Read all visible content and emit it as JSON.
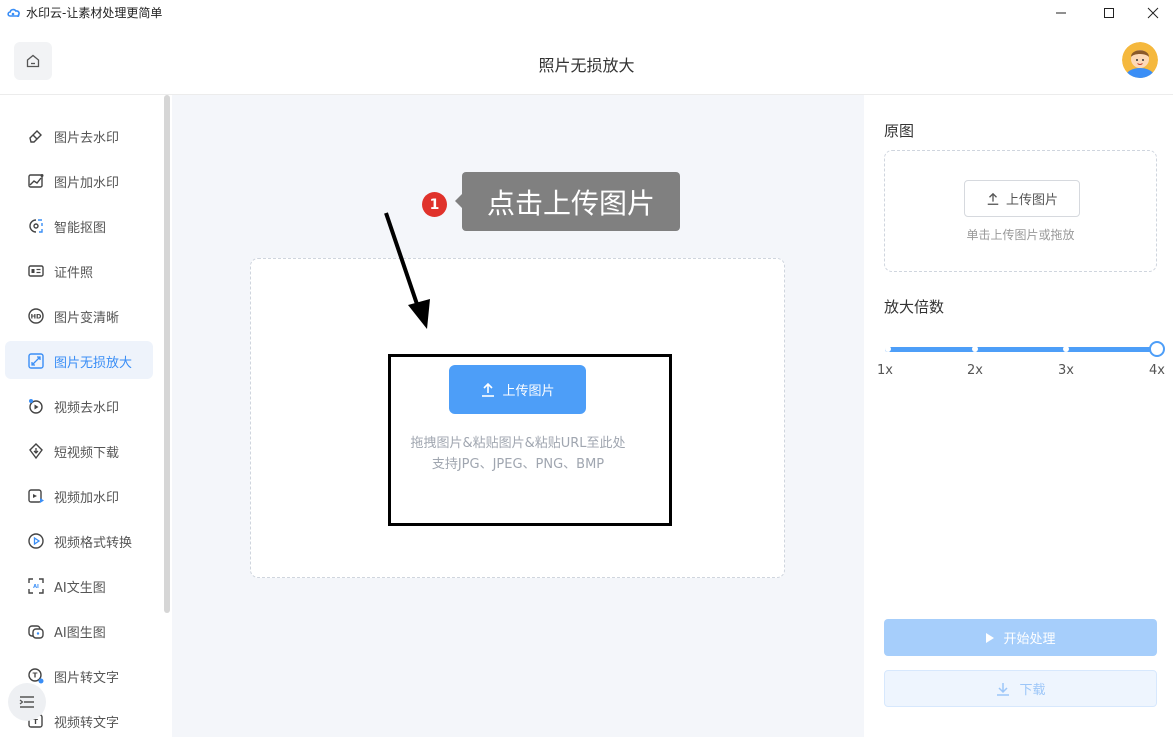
{
  "window": {
    "title": "水印云-让素材处理更简单"
  },
  "header": {
    "page_title": "照片无损放大"
  },
  "sidebar": {
    "items": [
      {
        "label": "图片去水印",
        "icon": "eraser-icon",
        "active": false
      },
      {
        "label": "图片加水印",
        "icon": "image-add-watermark-icon",
        "active": false
      },
      {
        "label": "智能抠图",
        "icon": "cutout-icon",
        "active": false
      },
      {
        "label": "证件照",
        "icon": "id-card-icon",
        "active": false
      },
      {
        "label": "图片变清晰",
        "icon": "hd-icon",
        "active": false
      },
      {
        "label": "图片无损放大",
        "icon": "enlarge-icon",
        "active": true
      },
      {
        "label": "视频去水印",
        "icon": "video-remove-watermark-icon",
        "active": false
      },
      {
        "label": "短视频下载",
        "icon": "download-video-icon",
        "active": false
      },
      {
        "label": "视频加水印",
        "icon": "video-add-watermark-icon",
        "active": false
      },
      {
        "label": "视频格式转换",
        "icon": "video-convert-icon",
        "active": false
      },
      {
        "label": "AI文生图",
        "icon": "ai-text-to-image-icon",
        "active": false
      },
      {
        "label": "AI图生图",
        "icon": "ai-image-to-image-icon",
        "active": false
      },
      {
        "label": "图片转文字",
        "icon": "image-to-text-icon",
        "active": false
      },
      {
        "label": "视频转文字",
        "icon": "video-to-text-icon",
        "active": false
      }
    ]
  },
  "main": {
    "upload_label": "上传图片",
    "hint_line1": "拖拽图片&粘贴图片&粘贴URL至此处",
    "hint_line2": "支持JPG、JPEG、PNG、BMP"
  },
  "annotation": {
    "step": "1",
    "tooltip": "点击上传图片"
  },
  "right_panel": {
    "original_title": "原图",
    "small_upload_label": "上传图片",
    "small_hint": "单击上传图片或拖放",
    "scale_title": "放大倍数",
    "scale_options": [
      "1x",
      "2x",
      "3x",
      "4x"
    ],
    "selected_scale": "4x",
    "start_label": "开始处理",
    "download_label": "下载"
  },
  "colors": {
    "accent": "#4d9ef8",
    "active_text": "#3a8ef6",
    "badge_red": "#e0322b",
    "tooltip_bg": "#808080"
  }
}
